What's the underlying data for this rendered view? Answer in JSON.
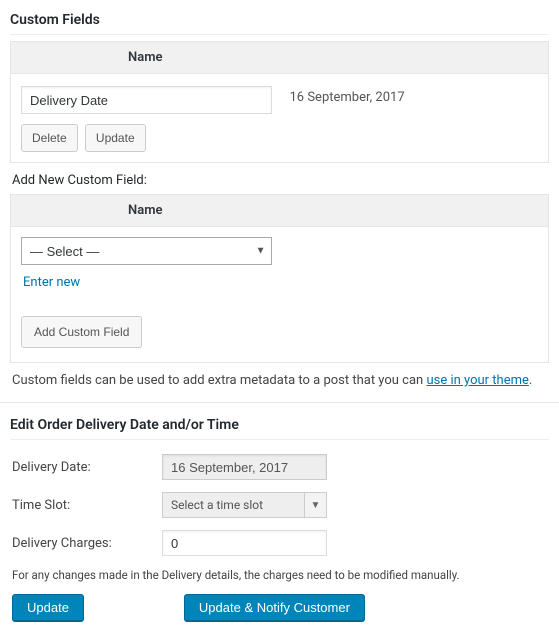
{
  "customFields": {
    "title": "Custom Fields",
    "headers": {
      "name": "Name"
    },
    "row": {
      "name": "Delivery Date",
      "value": "16 September, 2017",
      "deleteLabel": "Delete",
      "updateLabel": "Update"
    },
    "addNew": {
      "title": "Add New Custom Field:",
      "header": "Name",
      "selectPlaceholder": "— Select —",
      "enterNew": "Enter new",
      "addButton": "Add Custom Field"
    },
    "help": {
      "prefix": "Custom fields can be used to add extra metadata to a post that you can ",
      "linkText": "use in your theme",
      "suffix": "."
    }
  },
  "editOrder": {
    "title": "Edit Order Delivery Date and/or Time",
    "deliveryDateLabel": "Delivery Date:",
    "deliveryDateValue": "16 September, 2017",
    "timeSlotLabel": "Time Slot:",
    "timeSlotPlaceholder": "Select a time slot",
    "chargesLabel": "Delivery Charges:",
    "chargesValue": "0",
    "note": "For any changes made in the Delivery details, the charges need to be modified manually.",
    "updateLabel": "Update",
    "updateNotifyLabel": "Update & Notify Customer"
  }
}
